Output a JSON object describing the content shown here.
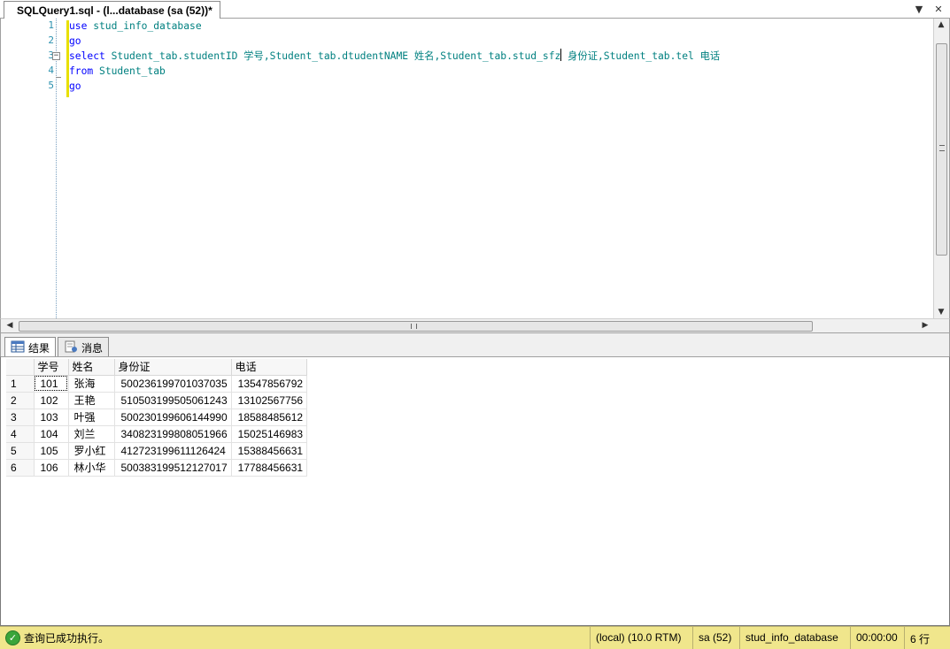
{
  "window": {
    "tab_title": "SQLQuery1.sql - (l...database (sa (52))*"
  },
  "editor": {
    "line_numbers": [
      "1",
      "2",
      "3",
      "4",
      "5"
    ],
    "lines": [
      {
        "kw": "use",
        "rest": " stud_info_database"
      },
      {
        "kw": "go",
        "rest": ""
      },
      {
        "kw": "select",
        "rest_a": " Student_tab.studentID 学号,Student_tab.dtudentNAME 姓名,Student_tab.stud_sfz",
        "rest_b": " 身份证,Student_tab.tel 电话"
      },
      {
        "kw": "from",
        "rest": " Student_tab"
      },
      {
        "kw": "go",
        "rest": ""
      }
    ]
  },
  "results": {
    "tabs": [
      {
        "label": "结果",
        "icon": "grid-icon",
        "active": true
      },
      {
        "label": "消息",
        "icon": "message-icon",
        "active": false
      }
    ],
    "columns": [
      "学号",
      "姓名",
      "身份证",
      "电话"
    ],
    "rows": [
      {
        "n": "1",
        "cells": [
          "101",
          "张海",
          "500236199701037035",
          "13547856792"
        ]
      },
      {
        "n": "2",
        "cells": [
          "102",
          "王艳",
          "510503199505061243",
          "13102567756"
        ]
      },
      {
        "n": "3",
        "cells": [
          "103",
          "叶强",
          "500230199606144990",
          "18588485612"
        ]
      },
      {
        "n": "4",
        "cells": [
          "104",
          "刘兰",
          "340823199808051966",
          "15025146983"
        ]
      },
      {
        "n": "5",
        "cells": [
          "105",
          "罗小红",
          "412723199611126424",
          "15388456631"
        ]
      },
      {
        "n": "6",
        "cells": [
          "106",
          "林小华",
          "500383199512127017",
          "17788456631"
        ]
      }
    ]
  },
  "status": {
    "message": "查询已成功执行。",
    "server": "(local) (10.0 RTM)",
    "user": "sa (52)",
    "database": "stud_info_database",
    "elapsed": "00:00:00",
    "rows": "6 行"
  },
  "colors": {
    "keyword": "#0000ff",
    "identifier": "#008080",
    "line_number": "#2b91af",
    "status_bar": "#f0e68c"
  }
}
